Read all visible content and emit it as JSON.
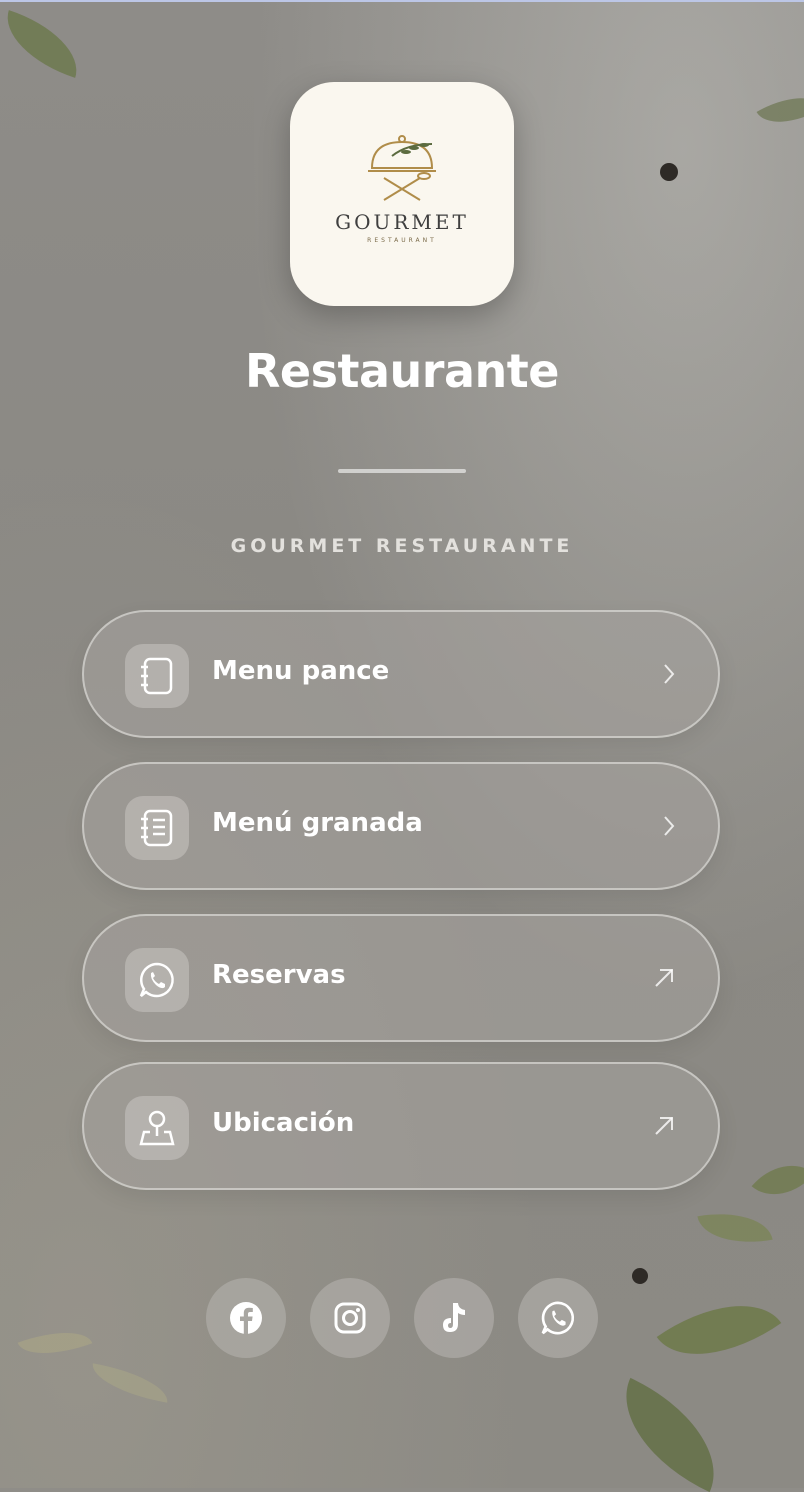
{
  "profile": {
    "logo": {
      "brand_word": "GOURMET",
      "brand_sub": "RESTAURANT",
      "icon": "cloche-with-fork-and-spoon-icon"
    },
    "title": "Restaurante",
    "subtitle": "GOURMET RESTAURANTE"
  },
  "links": [
    {
      "label": "Menu pance",
      "icon": "notebook-icon",
      "arrow": "chevron-right-icon"
    },
    {
      "label": "Menú granada",
      "icon": "menu-list-icon",
      "arrow": "chevron-right-icon"
    },
    {
      "label": "Reservas",
      "icon": "whatsapp-icon",
      "arrow": "external-arrow-icon"
    },
    {
      "label": "Ubicación",
      "icon": "location-pin-icon",
      "arrow": "external-arrow-icon"
    }
  ],
  "socials": [
    {
      "name": "facebook",
      "icon": "facebook-icon"
    },
    {
      "name": "instagram",
      "icon": "instagram-icon"
    },
    {
      "name": "tiktok",
      "icon": "tiktok-icon"
    },
    {
      "name": "whatsapp",
      "icon": "whatsapp-icon"
    }
  ],
  "colors": {
    "background": "#8f8d88",
    "logo_background": "#faf7ef",
    "text": "#ffffff",
    "accent_gold": "#b08d4a"
  }
}
